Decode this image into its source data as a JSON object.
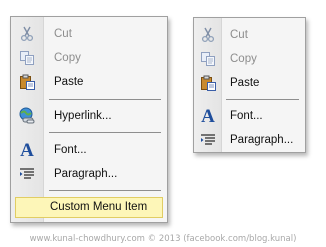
{
  "left_menu": {
    "items": [
      {
        "label": "Cut",
        "icon": "scissors-icon",
        "disabled": true
      },
      {
        "label": "Copy",
        "icon": "copy-icon",
        "disabled": true
      },
      {
        "label": "Paste",
        "icon": "paste-icon",
        "disabled": false
      },
      {
        "label": "Hyperlink...",
        "icon": "globe-link-icon",
        "disabled": false
      },
      {
        "label": "Font...",
        "icon": "font-icon",
        "disabled": false
      },
      {
        "label": "Paragraph...",
        "icon": "paragraph-icon",
        "disabled": false
      }
    ],
    "custom_item": {
      "label": "Custom Menu Item"
    }
  },
  "right_menu": {
    "items": [
      {
        "label": "Cut",
        "icon": "scissors-icon",
        "disabled": true
      },
      {
        "label": "Copy",
        "icon": "copy-icon",
        "disabled": true
      },
      {
        "label": "Paste",
        "icon": "paste-icon",
        "disabled": false
      },
      {
        "label": "Font...",
        "icon": "font-icon",
        "disabled": false
      },
      {
        "label": "Paragraph...",
        "icon": "paragraph-icon",
        "disabled": false
      }
    ]
  },
  "footer": {
    "text": "www.kunal-chowdhury.com © 2013 (facebook.com/blog.kunal)"
  },
  "colors": {
    "menu_background": "#f5f5f5",
    "highlight_background": "#fdf6b8",
    "highlight_border": "#e1cd63",
    "disabled_text": "#8d8d8d",
    "font_icon_blue": "#1f4e9c"
  }
}
